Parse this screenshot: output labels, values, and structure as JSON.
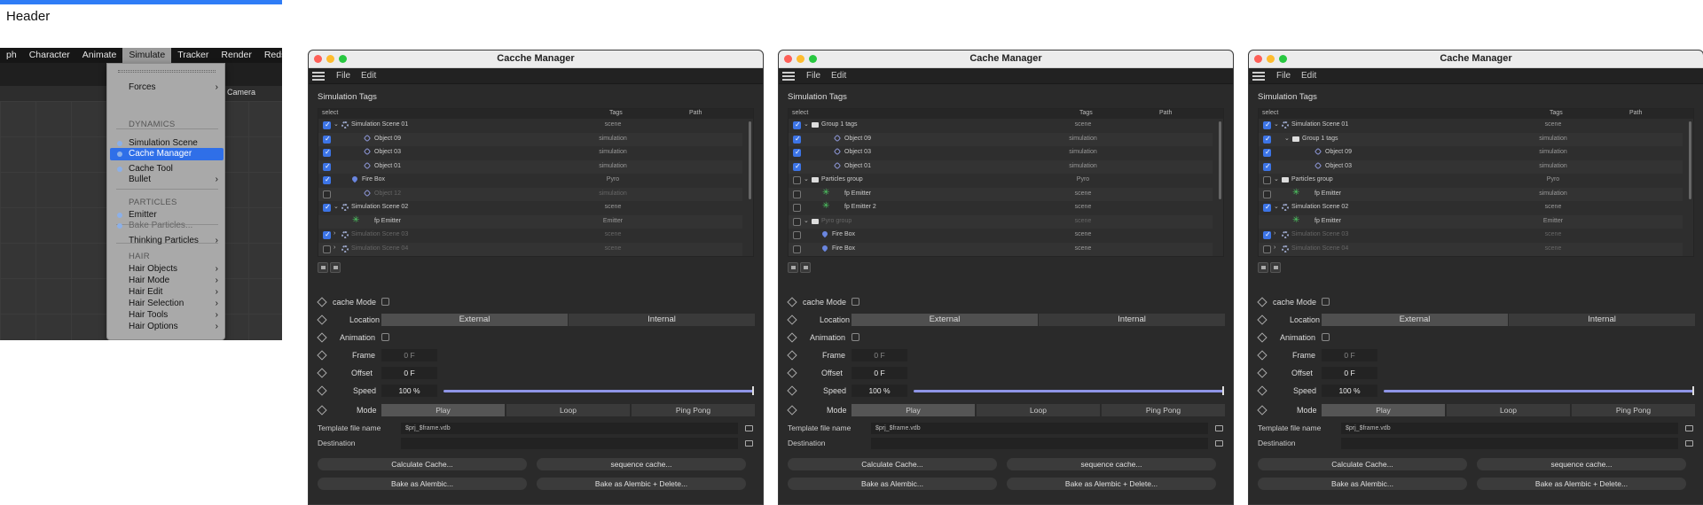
{
  "page": {
    "header": "Header"
  },
  "c4d": {
    "menubar": [
      "ph",
      "Character",
      "Animate",
      "Simulate",
      "Tracker",
      "Render",
      "Redshift"
    ],
    "camera_label": "Camera",
    "menu": {
      "items": [
        {
          "label": "Forces",
          "arrow": "›"
        },
        {
          "label": "Simulation Scene"
        },
        {
          "label": "Cache Manager"
        },
        {
          "label": "Cache Tool"
        },
        {
          "label": "Bullet",
          "arrow": "›"
        },
        {
          "label": "Emitter"
        },
        {
          "label": "Bake Particles..."
        },
        {
          "label": "Thinking Particles",
          "arrow": "›"
        },
        {
          "label": "Hair Objects",
          "arrow": "›"
        },
        {
          "label": "Hair Mode",
          "arrow": "›"
        },
        {
          "label": "Hair Edit",
          "arrow": "›"
        },
        {
          "label": "Hair Selection",
          "arrow": "›"
        },
        {
          "label": "Hair Tools",
          "arrow": "›"
        },
        {
          "label": "Hair Options",
          "arrow": "›"
        }
      ],
      "headings": [
        "DYNAMICS",
        "PARTICLES",
        "HAIR"
      ]
    }
  },
  "windows": [
    {
      "title": "Cacche Manager",
      "menu": [
        "File",
        "Edit"
      ],
      "section": "Simulation Tags",
      "columns": [
        "select",
        "Tags",
        "Path"
      ],
      "rows": [
        {
          "label": "Simulation Scene 01",
          "tag": "scene",
          "checked": true,
          "twirl": "⌄",
          "icon": "scene",
          "indent": 0
        },
        {
          "label": "Object 09",
          "tag": "simulation",
          "checked": true,
          "icon": "obj",
          "indent": 1
        },
        {
          "label": "Object 03",
          "tag": "simulation",
          "checked": true,
          "icon": "obj",
          "indent": 1
        },
        {
          "label": "Object 01",
          "tag": "simulation",
          "checked": true,
          "icon": "obj",
          "indent": 1
        },
        {
          "label": "Fire Box",
          "tag": "Pyro",
          "checked": true,
          "icon": "fire",
          "indent": 1
        },
        {
          "label": "Object 12",
          "tag": "simulation",
          "checked": false,
          "icon": "obj",
          "indent": 1,
          "dim": true
        },
        {
          "label": "Simulation Scene 02",
          "tag": "scene",
          "checked": true,
          "twirl": "⌄",
          "icon": "scene",
          "indent": 0
        },
        {
          "label": "fp Emitter",
          "tag": "Emitter",
          "checked": false,
          "icon": "emit",
          "indent": 1,
          "noCb": true
        },
        {
          "label": "Simulation Scene 03",
          "tag": "scene",
          "checked": true,
          "twirl": "›",
          "icon": "scene",
          "indent": 0,
          "dim": true
        },
        {
          "label": "Simulation Scene 04",
          "tag": "scene",
          "checked": false,
          "twirl": "›",
          "icon": "scene",
          "indent": 0,
          "dim": true
        }
      ],
      "props": {
        "cache_mode": "cache Mode",
        "location": "Location",
        "external": "External",
        "internal": "Internal",
        "animation": "Animation",
        "frame": "Frame",
        "frame_val": "0 F",
        "offset": "Offset",
        "offset_val": "0 F",
        "speed": "Speed",
        "speed_val": "100 %",
        "mode": "Mode",
        "modes": [
          "Play",
          "Loop",
          "Ping Pong"
        ],
        "template": "Template file name",
        "template_val": "$prj_$frame.vdb",
        "destination": "Destination",
        "buttons": [
          "Calculate Cache...",
          "sequence cache...",
          "Bake as Alembic...",
          "Bake as Alembic + Delete..."
        ]
      }
    },
    {
      "title": "Cache Manager",
      "menu": [
        "File",
        "Edit"
      ],
      "section": "Simulation Tags",
      "columns": [
        "select",
        "Tags",
        "Path"
      ],
      "rows": [
        {
          "label": "Group 1 tags",
          "tag": "scene",
          "checked": true,
          "twirl": "⌄",
          "icon": "folder",
          "indent": 0
        },
        {
          "label": "Object 09",
          "tag": "simulation",
          "checked": true,
          "icon": "obj",
          "indent": 1
        },
        {
          "label": "Object 03",
          "tag": "simulation",
          "checked": true,
          "icon": "obj",
          "indent": 1
        },
        {
          "label": "Object 01",
          "tag": "simulation",
          "checked": true,
          "icon": "obj",
          "indent": 1
        },
        {
          "label": "Particles group",
          "tag": "Pyro",
          "checked": false,
          "twirl": "⌄",
          "icon": "folder",
          "indent": 0
        },
        {
          "label": "fp Emitter",
          "tag": "scene",
          "checked": false,
          "icon": "emit",
          "indent": 1
        },
        {
          "label": "fp Emitter 2",
          "tag": "scene",
          "checked": false,
          "icon": "emit",
          "indent": 1
        },
        {
          "label": "Pyro group",
          "tag": "scene",
          "checked": false,
          "twirl": "⌄",
          "icon": "folder",
          "indent": 0,
          "dim": true
        },
        {
          "label": "Fire Box",
          "tag": "scene",
          "checked": false,
          "icon": "fire",
          "indent": 1
        },
        {
          "label": "Fire Box",
          "tag": "scene",
          "checked": false,
          "icon": "fire",
          "indent": 1
        }
      ],
      "props": {
        "cache_mode": "cache Mode",
        "location": "Location",
        "external": "External",
        "internal": "Internal",
        "animation": "Animation",
        "frame": "Frame",
        "frame_val": "0 F",
        "offset": "Offset",
        "offset_val": "0 F",
        "speed": "Speed",
        "speed_val": "100 %",
        "mode": "Mode",
        "modes": [
          "Play",
          "Loop",
          "Ping Pong"
        ],
        "template": "Template file name",
        "template_val": "$prj_$frame.vdb",
        "destination": "Destination",
        "buttons": [
          "Calculate Cache...",
          "sequence cache...",
          "Bake as Alembic...",
          "Bake as Alembic + Delete..."
        ]
      }
    },
    {
      "title": "Cache Manager",
      "menu": [
        "File",
        "Edit"
      ],
      "section": "Simulation Tags",
      "columns": [
        "select",
        "Tags",
        "Path"
      ],
      "rows": [
        {
          "label": "Simulation Scene 01",
          "tag": "scene",
          "checked": true,
          "twirl": "⌄",
          "icon": "scene",
          "indent": 0
        },
        {
          "label": "Group 1 tags",
          "tag": "simulation",
          "checked": true,
          "twirl": "⌄",
          "icon": "folder",
          "indent": 1
        },
        {
          "label": "Object 09",
          "tag": "simulation",
          "checked": true,
          "icon": "obj",
          "indent": 2
        },
        {
          "label": "Object 03",
          "tag": "simulation",
          "checked": true,
          "icon": "obj",
          "indent": 2
        },
        {
          "label": "Particles group",
          "tag": "Pyro",
          "checked": false,
          "twirl": "⌄",
          "icon": "folder",
          "indent": 0
        },
        {
          "label": "fp Emitter",
          "tag": "simulation",
          "checked": false,
          "icon": "emit",
          "indent": 1
        },
        {
          "label": "Simulation Scene 02",
          "tag": "scene",
          "checked": true,
          "twirl": "⌄",
          "icon": "scene",
          "indent": 0
        },
        {
          "label": "fp Emitter",
          "tag": "Emitter",
          "checked": false,
          "icon": "emit",
          "indent": 1,
          "noCb": true
        },
        {
          "label": "Simulation Scene 03",
          "tag": "scene",
          "checked": true,
          "twirl": "›",
          "icon": "scene",
          "indent": 0,
          "dim": true
        },
        {
          "label": "Simulation Scene 04",
          "tag": "scene",
          "checked": false,
          "twirl": "›",
          "icon": "scene",
          "indent": 0,
          "dim": true
        }
      ],
      "props": {
        "cache_mode": "cache Mode",
        "location": "Location",
        "external": "External",
        "internal": "Internal",
        "animation": "Animation",
        "frame": "Frame",
        "frame_val": "0 F",
        "offset": "Offset",
        "offset_val": "0 F",
        "speed": "Speed",
        "speed_val": "100 %",
        "mode": "Mode",
        "modes": [
          "Play",
          "Loop",
          "Ping Pong"
        ],
        "template": "Template file name",
        "template_val": "$prj_$frame.vdb",
        "destination": "Destination",
        "buttons": [
          "Calculate Cache...",
          "sequence cache...",
          "Bake as Alembic...",
          "Bake as Alembic + Delete..."
        ]
      }
    }
  ]
}
